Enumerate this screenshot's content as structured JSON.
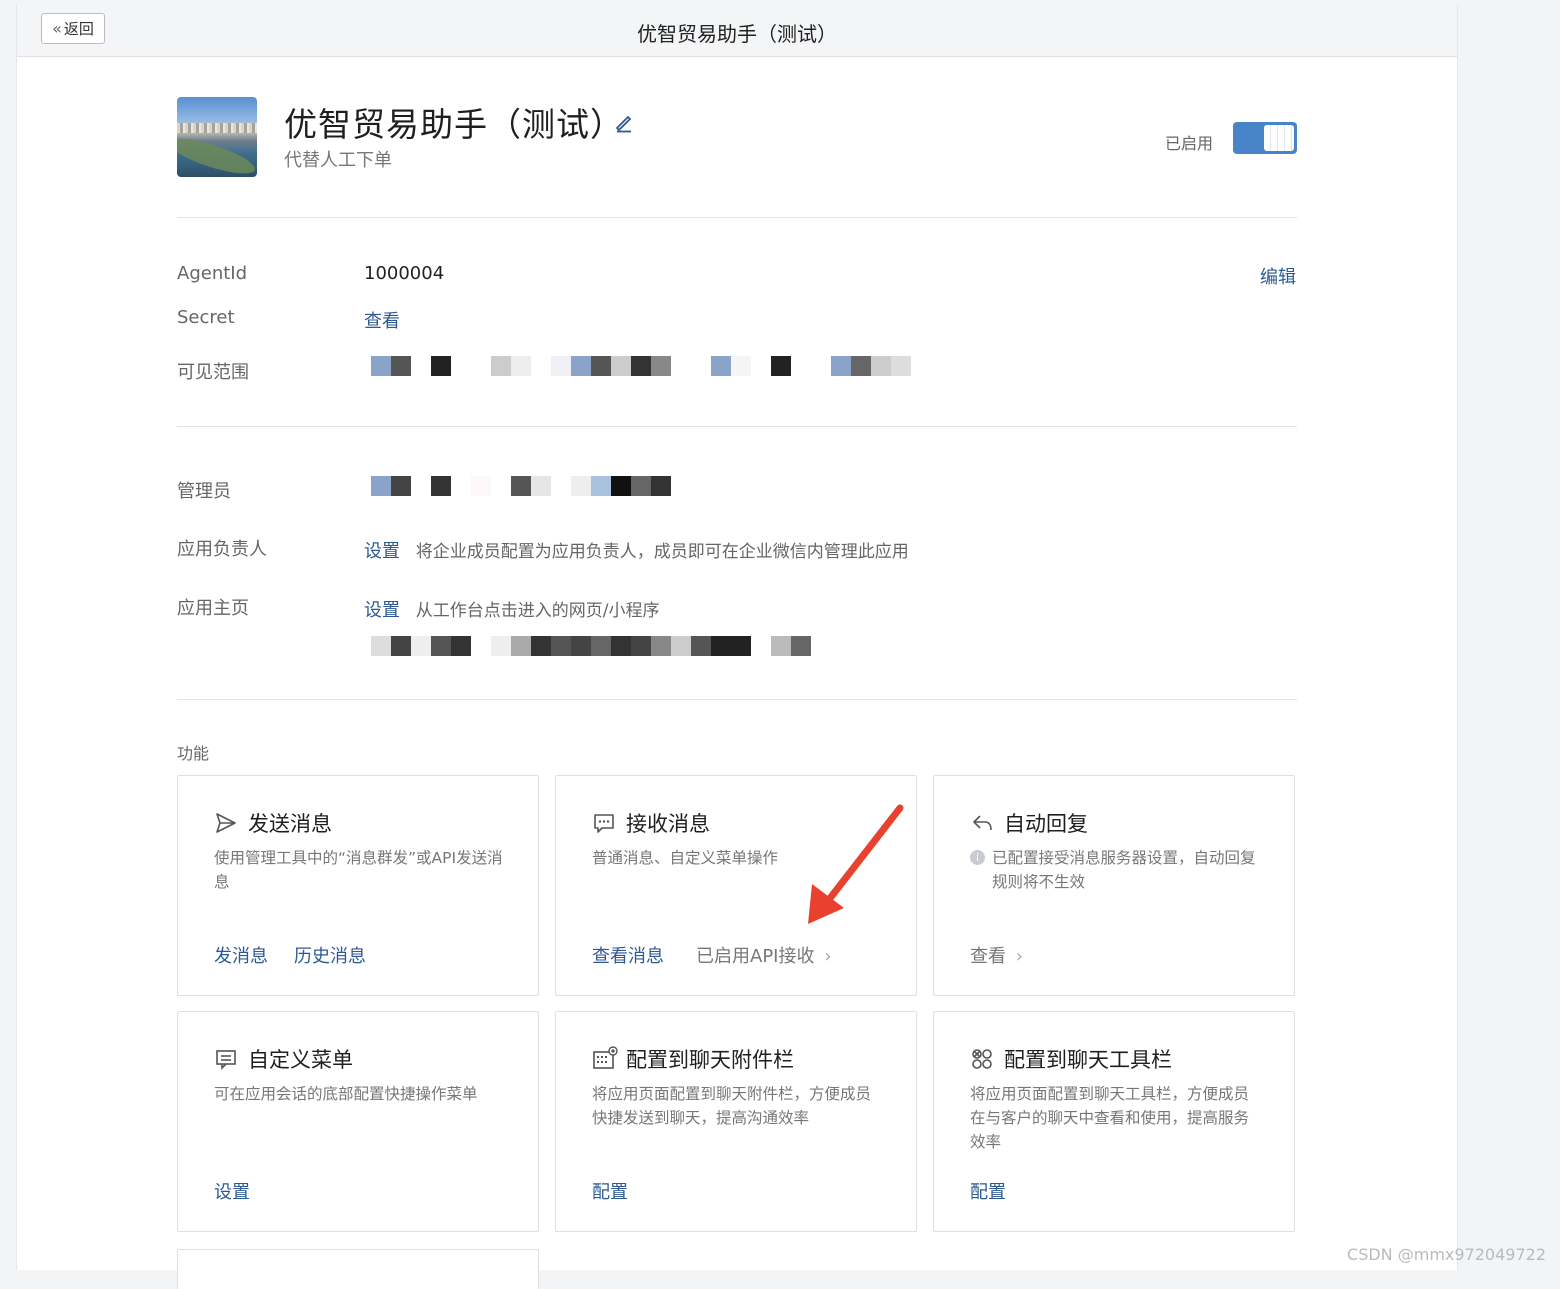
{
  "window": {
    "title": "优智贸易助手（测试）",
    "back_label": "返回"
  },
  "app": {
    "name": "优智贸易助手（测试）",
    "description": "代替人工下单",
    "status_label": "已启用",
    "enabled": true
  },
  "details": {
    "agentid_label": "AgentId",
    "agentid_value": "1000004",
    "edit_label": "编辑",
    "secret_label": "Secret",
    "secret_action": "查看",
    "visible_range_label": "可见范围"
  },
  "management": {
    "admin_label": "管理员",
    "owner_label": "应用负责人",
    "owner_action": "设置",
    "owner_hint": "将企业成员配置为应用负责人，成员即可在企业微信内管理此应用",
    "homepage_label": "应用主页",
    "homepage_action": "设置",
    "homepage_hint": "从工作台点击进入的网页/小程序"
  },
  "features": {
    "section_label": "功能",
    "cards": [
      {
        "title": "发送消息",
        "icon": "send-icon",
        "description": "使用管理工具中的“消息群发”或API发送消息",
        "actions": [
          "发消息",
          "历史消息"
        ]
      },
      {
        "title": "接收消息",
        "icon": "chat-bubble-icon",
        "description": "普通消息、自定义菜单操作",
        "actions": [
          "查看消息"
        ],
        "status_link": "已启用API接收"
      },
      {
        "title": "自动回复",
        "icon": "reply-icon",
        "description": "已配置接受消息服务器设置，自动回复规则将不生效",
        "status_link": "查看"
      },
      {
        "title": "自定义菜单",
        "icon": "menu-icon",
        "description": "可在应用会话的底部配置快捷操作菜单",
        "actions": [
          "设置"
        ]
      },
      {
        "title": "配置到聊天附件栏",
        "icon": "attachment-bar-icon",
        "description": "将应用页面配置到聊天附件栏，方便成员快捷发送到聊天，提高沟通效率",
        "actions": [
          "配置"
        ]
      },
      {
        "title": "配置到聊天工具栏",
        "icon": "toolbar-icon",
        "description": "将应用页面配置到聊天工具栏，方便成员在与客户的聊天中查看和使用，提高服务效率",
        "actions": [
          "配置"
        ]
      }
    ]
  },
  "watermark": "CSDN @mmx972049722",
  "colors": {
    "link": "#2e5a93",
    "toggle": "#4a84c8",
    "arrow": "#e8412d"
  }
}
